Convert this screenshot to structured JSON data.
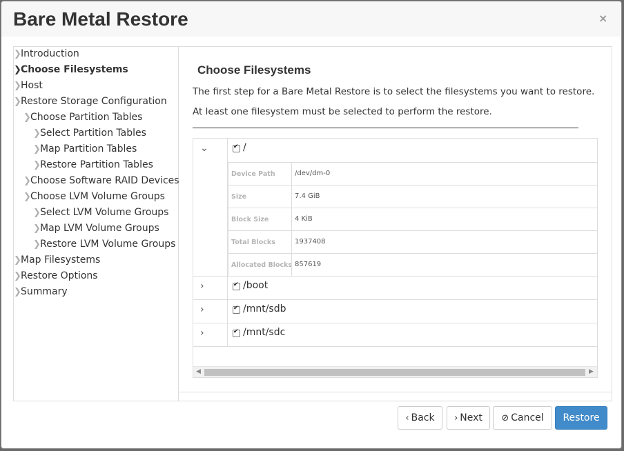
{
  "dialog": {
    "title": "Bare Metal Restore",
    "close_icon": "×"
  },
  "nav": {
    "chevron": "❯",
    "items": [
      {
        "label": "Introduction",
        "active": false
      },
      {
        "label": "Choose Filesystems",
        "active": true
      },
      {
        "label": "Host",
        "active": false
      },
      {
        "label": "Restore Storage Configuration",
        "active": false
      },
      {
        "label": "Choose Partition Tables",
        "active": false
      },
      {
        "label": "Select Partition Tables",
        "active": false
      },
      {
        "label": "Map Partition Tables",
        "active": false
      },
      {
        "label": "Restore Partition Tables",
        "active": false
      },
      {
        "label": "Choose Software RAID Devices",
        "active": false
      },
      {
        "label": "Choose LVM Volume Groups",
        "active": false
      },
      {
        "label": "Select LVM Volume Groups",
        "active": false
      },
      {
        "label": "Map LVM Volume Groups",
        "active": false
      },
      {
        "label": "Restore LVM Volume Groups",
        "active": false
      },
      {
        "label": "Map Filesystems",
        "active": false
      },
      {
        "label": "Restore Options",
        "active": false
      },
      {
        "label": "Summary",
        "active": false
      }
    ]
  },
  "content": {
    "title": "Choose Filesystems",
    "desc1": "The first step for a Bare Metal Restore is to select the filesystems you want to restore.",
    "desc2": "At least one filesystem must be selected to perform the restore."
  },
  "filesystems": [
    {
      "label": "/",
      "checked": true,
      "expanded": true,
      "toggle": "⌄",
      "details": [
        {
          "label": "Device Path",
          "value": "/dev/dm-0"
        },
        {
          "label": "Size",
          "value": "7.4 GiB"
        },
        {
          "label": "Block Size",
          "value": "4 KiB"
        },
        {
          "label": "Total Blocks",
          "value": "1937408"
        },
        {
          "label": "Allocated Blocks",
          "value": "857619"
        }
      ]
    },
    {
      "label": "/boot",
      "checked": true,
      "expanded": false,
      "toggle": "›"
    },
    {
      "label": "/mnt/sdb",
      "checked": true,
      "expanded": false,
      "toggle": "›"
    },
    {
      "label": "/mnt/sdc",
      "checked": true,
      "expanded": false,
      "toggle": "›"
    }
  ],
  "scrollbar": {
    "left_arrow": "◀",
    "right_arrow": "▶"
  },
  "buttons": {
    "back": {
      "icon": "‹",
      "label": "Back"
    },
    "next": {
      "icon": "›",
      "label": "Next"
    },
    "cancel": {
      "icon": "⊘",
      "label": "Cancel"
    },
    "restore": {
      "label": "Restore"
    }
  },
  "colors": {
    "primary": "#428bca",
    "border": "#dddddd",
    "text": "#333333"
  }
}
